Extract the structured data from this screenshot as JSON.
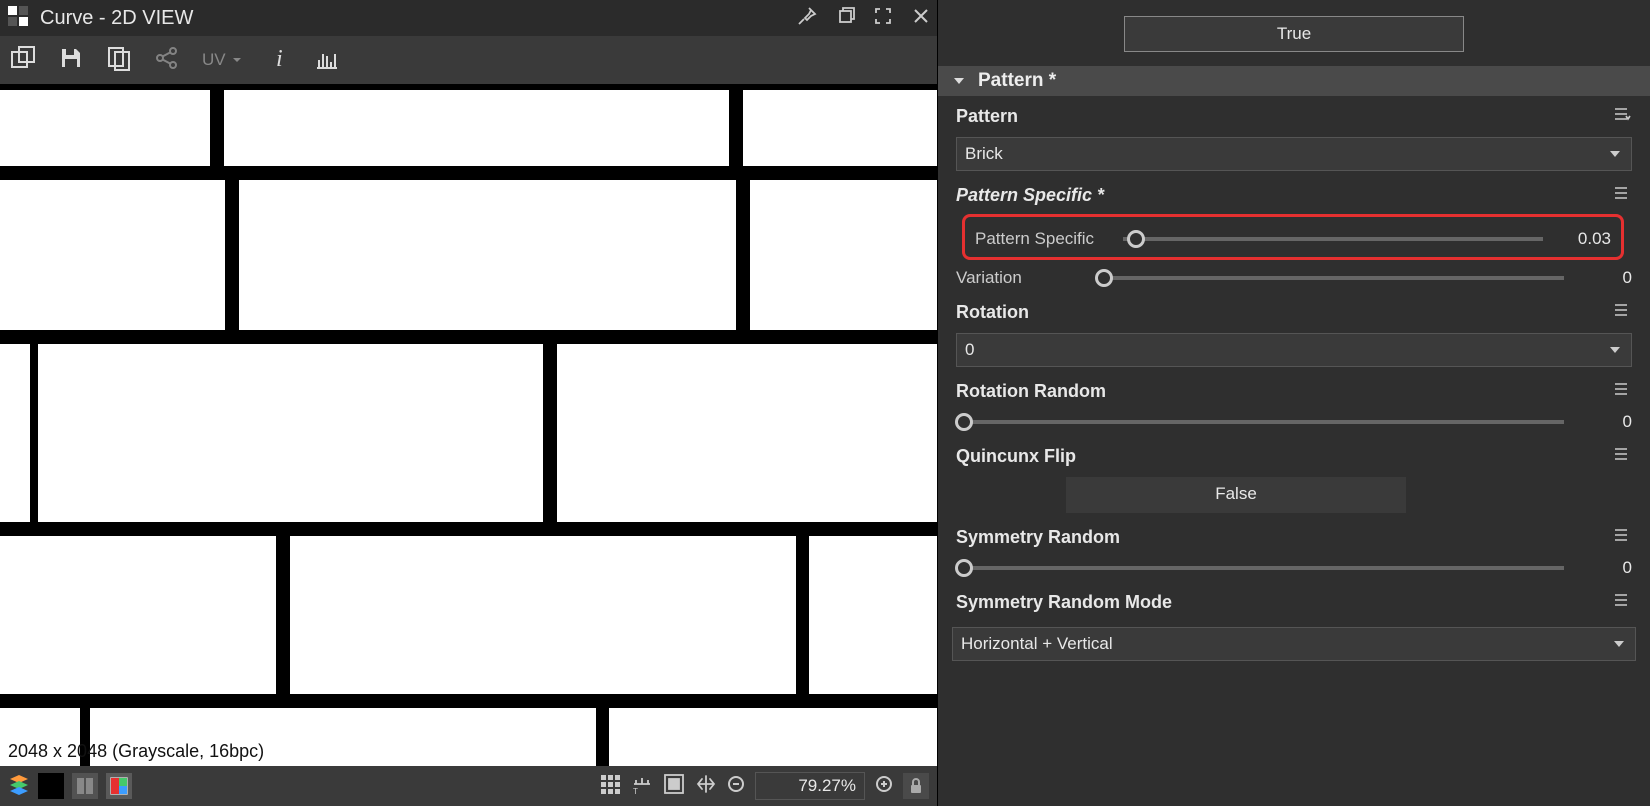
{
  "titlebar": {
    "title": "Curve - 2D VIEW"
  },
  "toolbar": {
    "uv_label": "UV"
  },
  "canvas": {
    "info": "2048 x 2048 (Grayscale, 16bpc)"
  },
  "bottombar": {
    "zoom": "79.27%"
  },
  "props": {
    "true_btn": "True",
    "section_title": "Pattern *",
    "pattern": {
      "label": "Pattern",
      "value": "Brick"
    },
    "pattern_specific_header": "Pattern Specific *",
    "pattern_specific": {
      "label": "Pattern Specific",
      "value": "0.03",
      "pos_pct": 3
    },
    "variation": {
      "label": "Variation",
      "value": "0",
      "pos_pct": 0
    },
    "rotation": {
      "label": "Rotation",
      "value": "0"
    },
    "rotation_random": {
      "label": "Rotation Random",
      "value": "0",
      "pos_pct": 0
    },
    "quincunx_flip": {
      "label": "Quincunx Flip",
      "value": "False"
    },
    "symmetry_random": {
      "label": "Symmetry Random",
      "value": "0",
      "pos_pct": 0
    },
    "symmetry_random_mode": {
      "label": "Symmetry Random Mode",
      "value": "Horizontal + Vertical"
    }
  }
}
